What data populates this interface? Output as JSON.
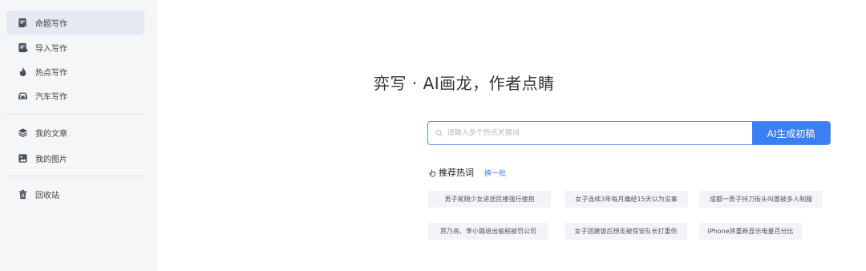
{
  "sidebar": {
    "items": [
      {
        "label": "命题写作",
        "icon": "doc-edit-icon"
      },
      {
        "label": "导入写作",
        "icon": "doc-import-icon"
      },
      {
        "label": "热点写作",
        "icon": "flame-icon"
      },
      {
        "label": "汽车写作",
        "icon": "car-icon"
      },
      {
        "label": "我的文章",
        "icon": "layers-icon"
      },
      {
        "label": "我的图片",
        "icon": "image-icon"
      },
      {
        "label": "回收站",
        "icon": "trash-icon"
      }
    ],
    "active_index": 0
  },
  "hero": {
    "title": "弈写 · AI画龙，作者点睛"
  },
  "search": {
    "placeholder": "请输入多个热点关键词",
    "value": "",
    "button_label": "AI生成初稿"
  },
  "hot": {
    "title": "推荐热词",
    "refresh_label": "换一批",
    "tags": [
      "男子尾随少女进居民楼强行搂抱",
      "女子连续3年每月痛经15天以为没事",
      "成都一男子持刀街头叫嚣被多人制服",
      "贾乃亮、李小璐退出偷税被罚公司",
      "女子团建饭后想走被保安队长打重伤",
      "iPhone将重新显示电量百分比"
    ]
  },
  "colors": {
    "accent": "#3a80f3",
    "sidebar_bg": "#f5f6f8",
    "active_bg": "#e4e9f3",
    "tag_bg": "#f2f4f7"
  }
}
